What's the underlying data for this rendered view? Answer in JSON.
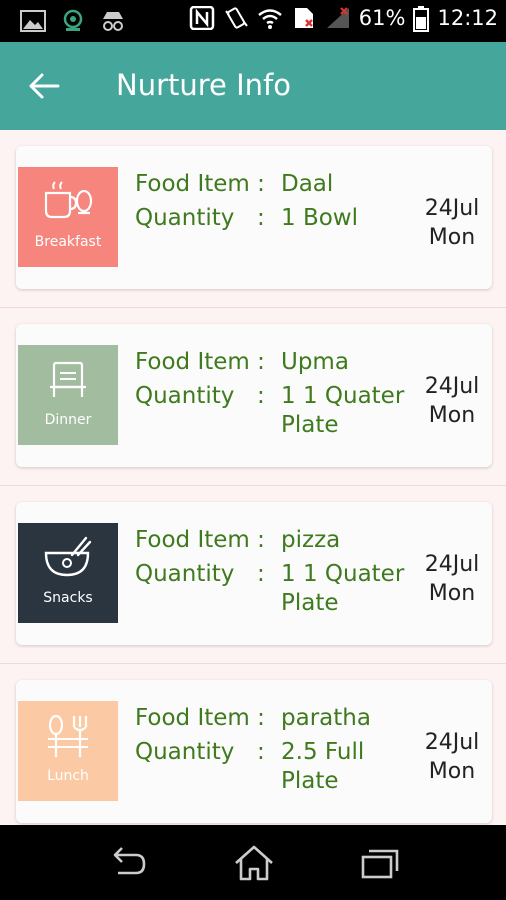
{
  "status_bar": {
    "battery_percent": "61%",
    "time": "12:12",
    "icons": [
      "image-icon",
      "app-icon",
      "incognito-icon",
      "nfc-icon",
      "vibrate-icon",
      "wifi-icon",
      "sim-icon",
      "signal-icon",
      "battery-icon"
    ]
  },
  "app_bar": {
    "title": "Nurture Info",
    "back_icon": "back-arrow-icon"
  },
  "entries": [
    {
      "meal": "Breakfast",
      "icon": "breakfast-icon",
      "color": "#f5857d",
      "food_label": "Food Item :",
      "food": "Daal",
      "qty_label": "Quantity",
      "colon": ":",
      "qty_line1": "1 Bowl",
      "qty_line2": "",
      "date_line1": "24Jul",
      "date_line2": "Mon"
    },
    {
      "meal": "Dinner",
      "icon": "dinner-icon",
      "color": "#a2bc9f",
      "food_label": "Food Item :",
      "food": "Upma",
      "qty_label": "Quantity",
      "colon": ":",
      "qty_line1": "1 1 Quater",
      "qty_line2": "Plate",
      "date_line1": "24Jul",
      "date_line2": "Mon"
    },
    {
      "meal": "Snacks",
      "icon": "snacks-icon",
      "color": "#2b3540",
      "food_label": "Food Item :",
      "food": "pizza",
      "qty_label": "Quantity",
      "colon": ":",
      "qty_line1": "1 1 Quater",
      "qty_line2": "Plate",
      "date_line1": "24Jul",
      "date_line2": "Mon"
    },
    {
      "meal": "Lunch",
      "icon": "lunch-icon",
      "color": "#fbc9a3",
      "food_label": "Food Item :",
      "food": "paratha",
      "qty_label": "Quantity",
      "colon": ":",
      "qty_line1": "2.5 Full",
      "qty_line2": "Plate",
      "date_line1": "24Jul",
      "date_line2": "Mon"
    }
  ],
  "nav_bar": {
    "icons": [
      "back-icon",
      "home-icon",
      "recents-icon"
    ]
  },
  "colors": {
    "app_bar": "#45a69b",
    "text_green": "#3f7a1e",
    "background": "#fdf3f2"
  }
}
